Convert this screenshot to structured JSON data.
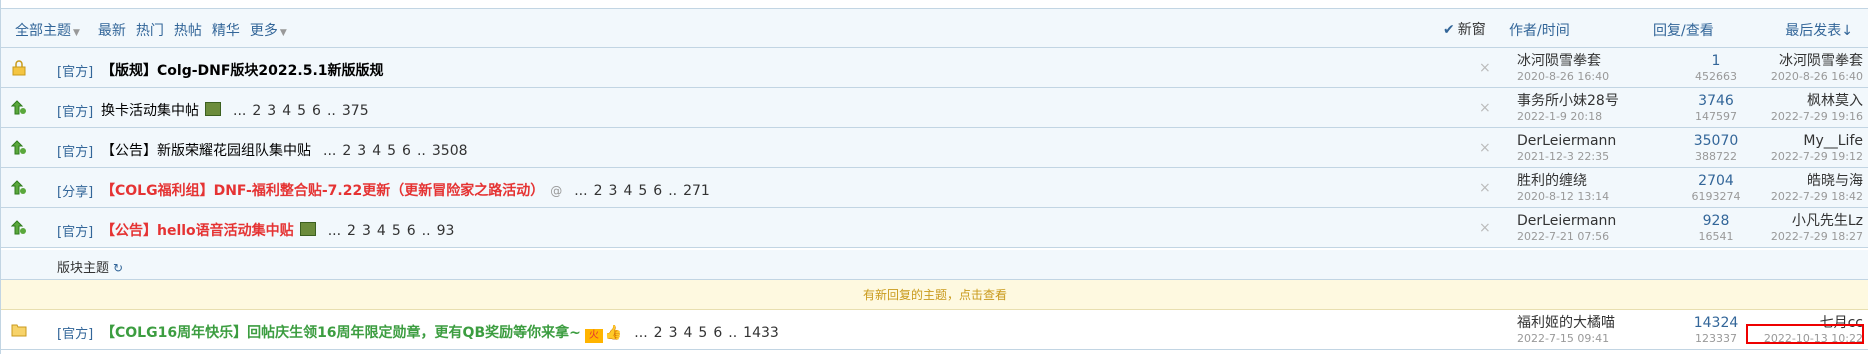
{
  "header": {
    "all_topics": "全部主题",
    "filters": [
      "最新",
      "热门",
      "热帖",
      "精华",
      "更多"
    ],
    "new_window": "新窗",
    "author_time": "作者/时间",
    "reply_view": "回复/查看",
    "last_post": "最后发表↓"
  },
  "threads": [
    {
      "category": "[官方]",
      "title": "【版规】Colg-DNF版块2022.5.1新版版规",
      "style": "bold",
      "pages": [],
      "author": "冰河陨雪拳套",
      "author_time": "2020-8-26 16:40",
      "replies": "1",
      "views": "452663",
      "last_user": "冰河陨雪拳套",
      "last_time": "2020-8-26 16:40",
      "icon": "lock"
    },
    {
      "category": "[官方]",
      "title": "换卡活动集中帖",
      "style": "normal",
      "pages": [
        "...",
        "2",
        "3",
        "4",
        "5",
        "6",
        "..",
        "375"
      ],
      "author": "事务所小妹28号",
      "author_time": "2022-1-9 20:18",
      "replies": "3746",
      "views": "147597",
      "last_user": "枫林莫入",
      "last_time": "2022-7-29 19:16",
      "icon": "pin"
    },
    {
      "category": "[官方]",
      "title": "【公告】新版荣耀花园组队集中贴",
      "style": "normal",
      "pages": [
        "...",
        "2",
        "3",
        "4",
        "5",
        "6",
        "..",
        "3508"
      ],
      "author": "DerLeiermann",
      "author_time": "2021-12-3 22:35",
      "replies": "35070",
      "views": "388722",
      "last_user": "My__Life",
      "last_time": "2022-7-29 19:12",
      "icon": "pin"
    },
    {
      "category": "[分享]",
      "title": "【COLG福利组】DNF-福利整合贴-7.22更新（更新冒险家之路活动）",
      "style": "red",
      "pages": [
        "...",
        "2",
        "3",
        "4",
        "5",
        "6",
        "..",
        "271"
      ],
      "author": "胜利的缠绕",
      "author_time": "2020-8-12 13:14",
      "replies": "2704",
      "views": "6193274",
      "last_user": "皓晓与海",
      "last_time": "2022-7-29 18:42",
      "icon": "pin"
    },
    {
      "category": "[官方]",
      "title": "【公告】hello语音活动集中贴",
      "style": "red",
      "pages": [
        "...",
        "2",
        "3",
        "4",
        "5",
        "6",
        "..",
        "93"
      ],
      "author": "DerLeiermann",
      "author_time": "2022-7-21 07:56",
      "replies": "928",
      "views": "16541",
      "last_user": "小凡先生Lz",
      "last_time": "2022-7-29 18:27",
      "icon": "pin"
    }
  ],
  "section_label": "版块主题",
  "notice": "有新回复的主题，点击查看",
  "normal_thread": {
    "category": "[官方]",
    "title": "【COLG16周年快乐】回帖庆生领16周年限定勋章，更有QB奖励等你来拿~",
    "badge": "火",
    "pages": [
      "...",
      "2",
      "3",
      "4",
      "5",
      "6",
      "..",
      "1433"
    ],
    "author": "福利姬的大橘喵",
    "author_time": "2022-7-15 09:41",
    "replies": "14324",
    "views": "123337",
    "last_user": "七月cc",
    "last_time": "2022-10-13 10:22"
  }
}
